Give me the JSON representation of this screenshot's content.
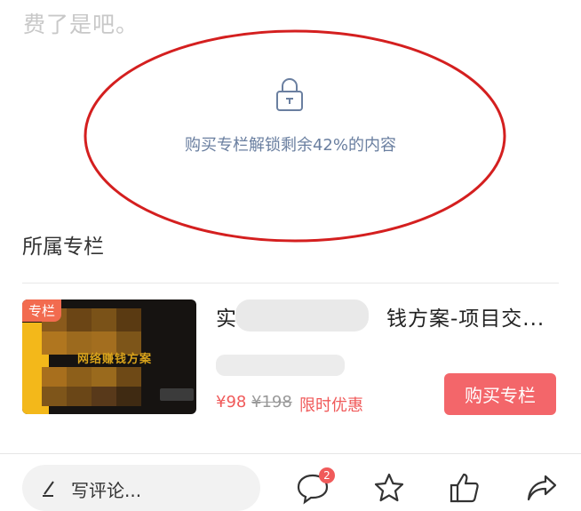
{
  "article": {
    "faded_tail": "费了是吧。",
    "unlock_text": "购买专栏解锁剩余42%的内容",
    "lock_icon": "lock-icon"
  },
  "section": {
    "title": "所属专栏"
  },
  "column_card": {
    "tag": "专栏",
    "thumb_subtitle": "网络赚钱方案",
    "title": "实　　　　　　　钱方案-项目交...",
    "price_now": "¥98",
    "price_old": "¥198",
    "price_tag": "限时优惠",
    "buy_label": "购买专栏"
  },
  "bottom_bar": {
    "comment_placeholder": "写评论...",
    "comment_count": "2",
    "icons": [
      "pen-icon",
      "comment-icon",
      "star-icon",
      "thumbs-up-icon",
      "share-icon"
    ]
  },
  "colors": {
    "accent_red": "#f05a5a",
    "unlock_blue": "#6a7fa0",
    "annotation_red": "#d41f1f"
  }
}
